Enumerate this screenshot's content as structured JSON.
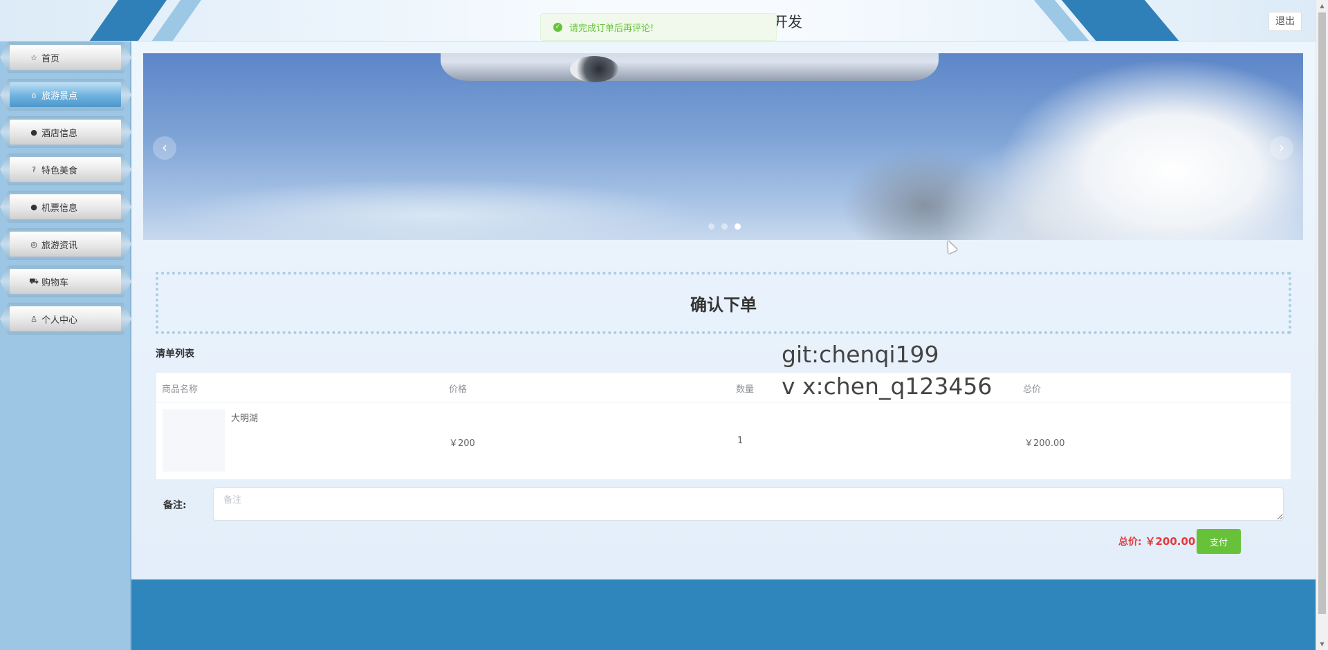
{
  "header": {
    "title": "开发",
    "logout_label": "退出"
  },
  "toast": {
    "message": "请完成订单后再评论!",
    "icon": "check-circle-icon",
    "color": "#67c23a"
  },
  "sidebar": {
    "items": [
      {
        "label": "首页",
        "icon": "star-icon"
      },
      {
        "label": "旅游景点",
        "icon": "bag-icon"
      },
      {
        "label": "酒店信息",
        "icon": "info-icon"
      },
      {
        "label": "特色美食",
        "icon": "question-icon"
      },
      {
        "label": "机票信息",
        "icon": "info-icon"
      },
      {
        "label": "旅游资讯",
        "icon": "globe-icon"
      },
      {
        "label": "购物车",
        "icon": "cart-icon"
      },
      {
        "label": "个人中心",
        "icon": "user-icon"
      }
    ],
    "active_index": 1
  },
  "carousel": {
    "prev_label": "‹",
    "next_label": "›",
    "slide_count": 3,
    "active_slide": 3
  },
  "main": {
    "heading": "确认下单",
    "list_label": "清单列表",
    "table": {
      "headers": [
        "商品名称",
        "价格",
        "数量",
        "总价"
      ],
      "rows": [
        {
          "name": "大明湖",
          "price": "￥200",
          "quantity": "1",
          "total": "￥200.00"
        }
      ]
    },
    "remark_label": "备注:",
    "remark_placeholder": "备注",
    "remark_value": "",
    "total_label": "总价:",
    "total_value": "￥200.00",
    "pay_label": "支付"
  },
  "watermark": {
    "line1": "git:chenqi199",
    "line2": "v x:chen_q123456"
  },
  "colors": {
    "accent": "#2f86bc",
    "sidebar": "#9cc6e4",
    "price_red": "#e4393c",
    "success": "#67c23a"
  }
}
